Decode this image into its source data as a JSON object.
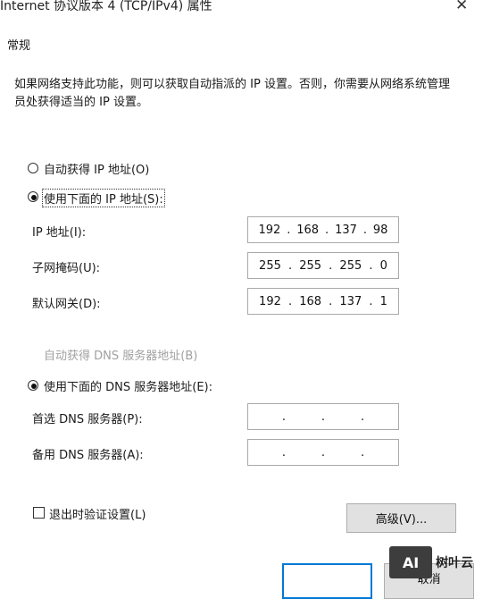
{
  "window": {
    "title": "Internet 协议版本 4 (TCP/IPv4) 属性",
    "close_icon": "close-icon"
  },
  "tab": {
    "label": "常规"
  },
  "description": "如果网络支持此功能，则可以获取自动指派的 IP 设置。否则，你需要从网络系统管理员处获得适当的 IP 设置。",
  "ip_section": {
    "auto_label": "自动获得 IP 地址(O)",
    "manual_label": "使用下面的 IP 地址(S):",
    "selected": "manual",
    "fields": [
      {
        "label": "IP 地址(I):",
        "octets": [
          "192",
          "168",
          "137",
          "98"
        ]
      },
      {
        "label": "子网掩码(U):",
        "octets": [
          "255",
          "255",
          "255",
          "0"
        ]
      },
      {
        "label": "默认网关(D):",
        "octets": [
          "192",
          "168",
          "137",
          "1"
        ]
      }
    ]
  },
  "dns_section": {
    "auto_label": "自动获得 DNS 服务器地址(B)",
    "manual_label": "使用下面的 DNS 服务器地址(E):",
    "selected": "manual",
    "fields": [
      {
        "label": "首选 DNS 服务器(P):",
        "octets": [
          "",
          "",
          "",
          ""
        ]
      },
      {
        "label": "备用 DNS 服务器(A):",
        "octets": [
          "",
          "",
          "",
          ""
        ]
      }
    ]
  },
  "validate": {
    "label": "退出时验证设置(L)",
    "checked": false
  },
  "buttons": {
    "advanced": "高级(V)...",
    "cancel": "取消"
  },
  "watermark": {
    "logo_text": "AI",
    "brand": "树叶云"
  }
}
